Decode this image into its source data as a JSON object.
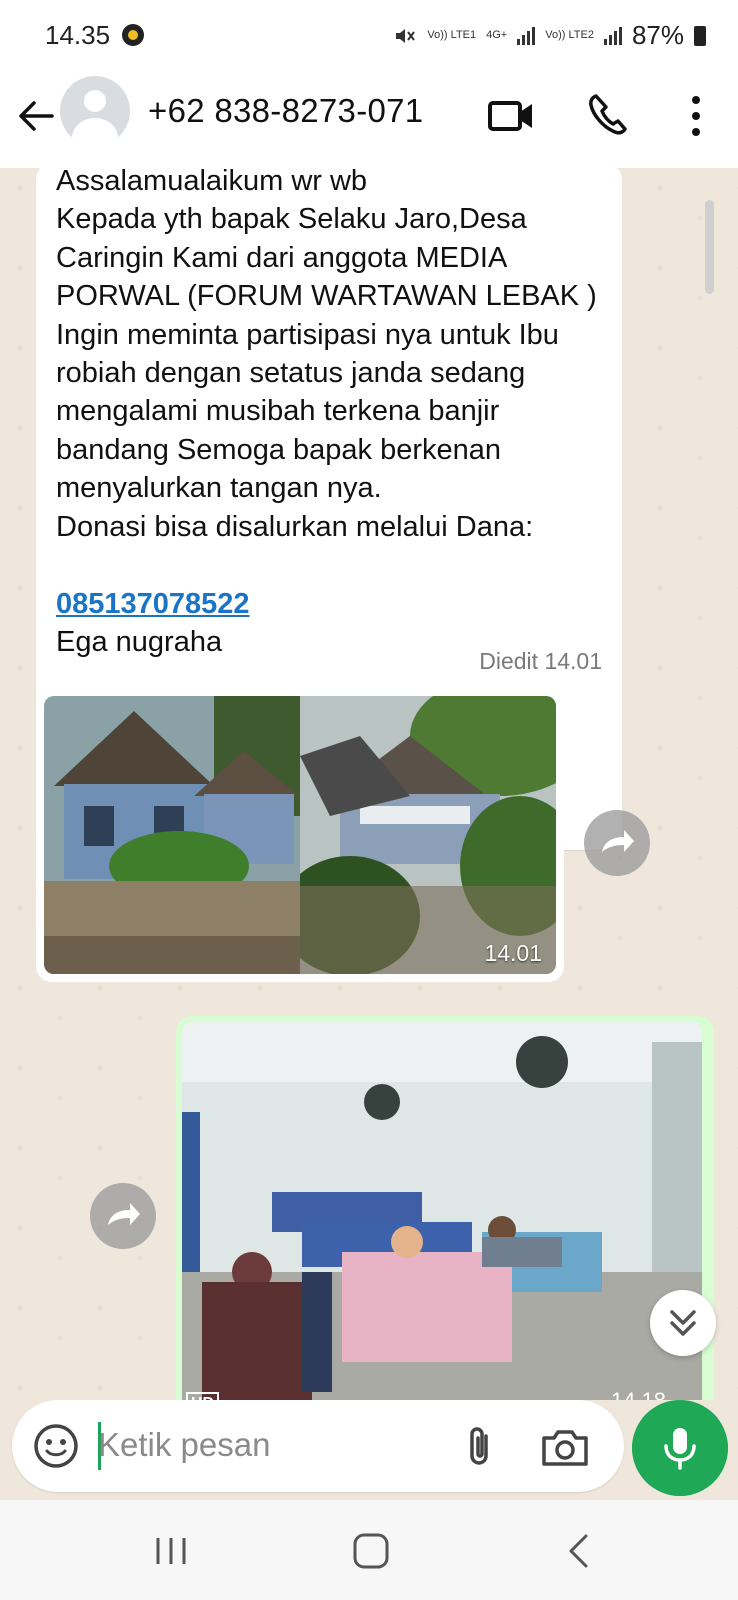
{
  "status_bar": {
    "time": "14.35",
    "network1": "Vo)) LTE1",
    "network_type": "4G+",
    "network2": "Vo)) LTE2",
    "battery": "87%"
  },
  "header": {
    "contact_name": "+62 838-8273-071"
  },
  "messages": [
    {
      "type": "text",
      "direction": "incoming",
      "text": "Assalamualaikum wr wb\nKepada yth bapak Selaku Jaro,Desa Caringin Kami dari anggota MEDIA PORWAL (FORUM WARTAWAN LEBAK ) Ingin meminta partisipasi nya untuk Ibu robiah dengan setatus janda sedang mengalami musibah terkena banjir bandang Semoga bapak berkenan menyalurkan tangan nya.\nDonasi bisa disalurkan melalui Dana:",
      "link": "085137078522",
      "signature": "Ega nugraha",
      "meta": "Diedit 14.01"
    },
    {
      "type": "images",
      "direction": "incoming",
      "time": "14.01"
    },
    {
      "type": "image",
      "direction": "outgoing",
      "badge": "HD",
      "time": "14.18"
    }
  ],
  "input": {
    "placeholder": "Ketik pesan"
  }
}
